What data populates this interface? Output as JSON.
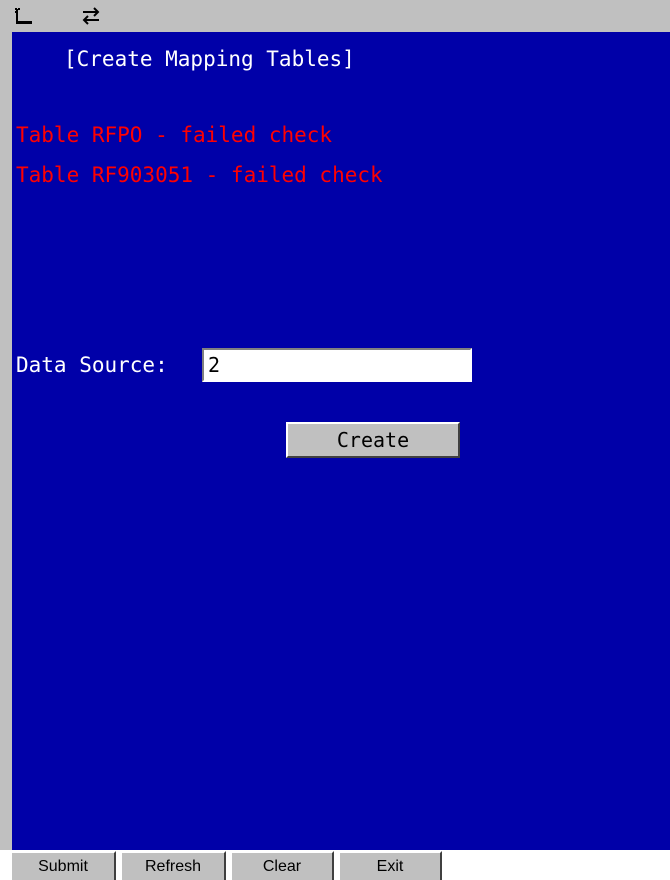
{
  "status_bar": {
    "icons": [
      "signal-icon",
      "sync-icon"
    ]
  },
  "screen": {
    "title": "[Create Mapping Tables]",
    "errors": [
      "Table RFPO - failed check",
      "Table RF903051 - failed check"
    ],
    "data_source": {
      "label": "Data Source:",
      "value": "2"
    },
    "create_label": "Create"
  },
  "softkeys": {
    "submit": "Submit",
    "refresh": "Refresh",
    "clear": "Clear",
    "exit": "Exit"
  },
  "colors": {
    "screen_background": "#0000a8",
    "title_text": "#ffffff",
    "error_text": "#ff0000",
    "chrome": "#c0c0c0"
  }
}
